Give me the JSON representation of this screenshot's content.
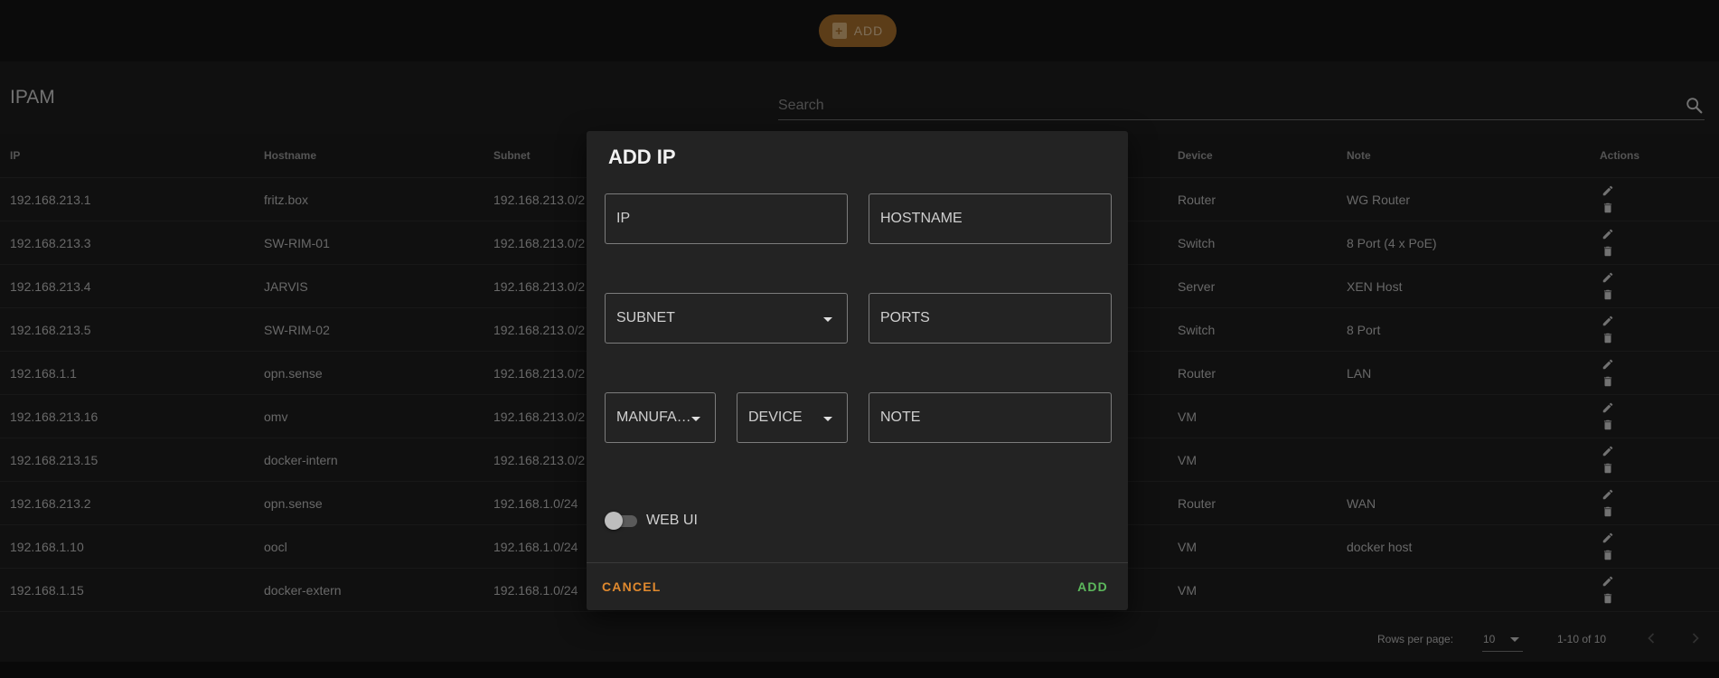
{
  "topbar": {
    "add_label": "ADD",
    "add_icon": "clipboard-plus-icon"
  },
  "page": {
    "title": "IPAM"
  },
  "search": {
    "placeholder": "Search",
    "icon": "search-icon"
  },
  "table": {
    "columns": [
      "IP",
      "Hostname",
      "Subnet",
      "",
      "",
      "Device",
      "Note",
      "Actions"
    ],
    "rows": [
      {
        "ip": "192.168.213.1",
        "hostname": "fritz.box",
        "subnet": "192.168.213.0/2",
        "device": "Router",
        "note": "WG Router"
      },
      {
        "ip": "192.168.213.3",
        "hostname": "SW-RIM-01",
        "subnet": "192.168.213.0/2",
        "device": "Switch",
        "note": "8 Port (4 x PoE)"
      },
      {
        "ip": "192.168.213.4",
        "hostname": "JARVIS",
        "subnet": "192.168.213.0/2",
        "device": "Server",
        "note": "XEN Host"
      },
      {
        "ip": "192.168.213.5",
        "hostname": "SW-RIM-02",
        "subnet": "192.168.213.0/2",
        "device": "Switch",
        "note": "8 Port"
      },
      {
        "ip": "192.168.1.1",
        "hostname": "opn.sense",
        "subnet": "192.168.213.0/2",
        "device": "Router",
        "note": "LAN"
      },
      {
        "ip": "192.168.213.16",
        "hostname": "omv",
        "subnet": "192.168.213.0/2",
        "device": "VM",
        "note": ""
      },
      {
        "ip": "192.168.213.15",
        "hostname": "docker-intern",
        "subnet": "192.168.213.0/2",
        "device": "VM",
        "note": ""
      },
      {
        "ip": "192.168.213.2",
        "hostname": "opn.sense",
        "subnet": "192.168.1.0/24",
        "device": "Router",
        "note": "WAN"
      },
      {
        "ip": "192.168.1.10",
        "hostname": "oocl",
        "subnet": "192.168.1.0/24",
        "device": "VM",
        "note": "docker host"
      },
      {
        "ip": "192.168.1.15",
        "hostname": "docker-extern",
        "subnet": "192.168.1.0/24",
        "device": "VM",
        "note": ""
      }
    ]
  },
  "pagination": {
    "rows_per_page_label": "Rows per page:",
    "rows_per_page": "10",
    "range": "1-10 of 10"
  },
  "dialog": {
    "title": "ADD IP",
    "fields": {
      "ip": "IP",
      "hostname": "HOSTNAME",
      "subnet": "SUBNET",
      "ports": "PORTS",
      "manufacturer": "MANUFAC...",
      "device": "DEVICE",
      "note": "NOTE"
    },
    "toggle_label": "WEB UI",
    "toggle_on": false,
    "cancel_label": "CANCEL",
    "add_label": "ADD"
  },
  "colors": {
    "accent": "#a86f2c",
    "cancel": "#e0892e",
    "add": "#5cb85c",
    "background": "#1e1e1e"
  }
}
